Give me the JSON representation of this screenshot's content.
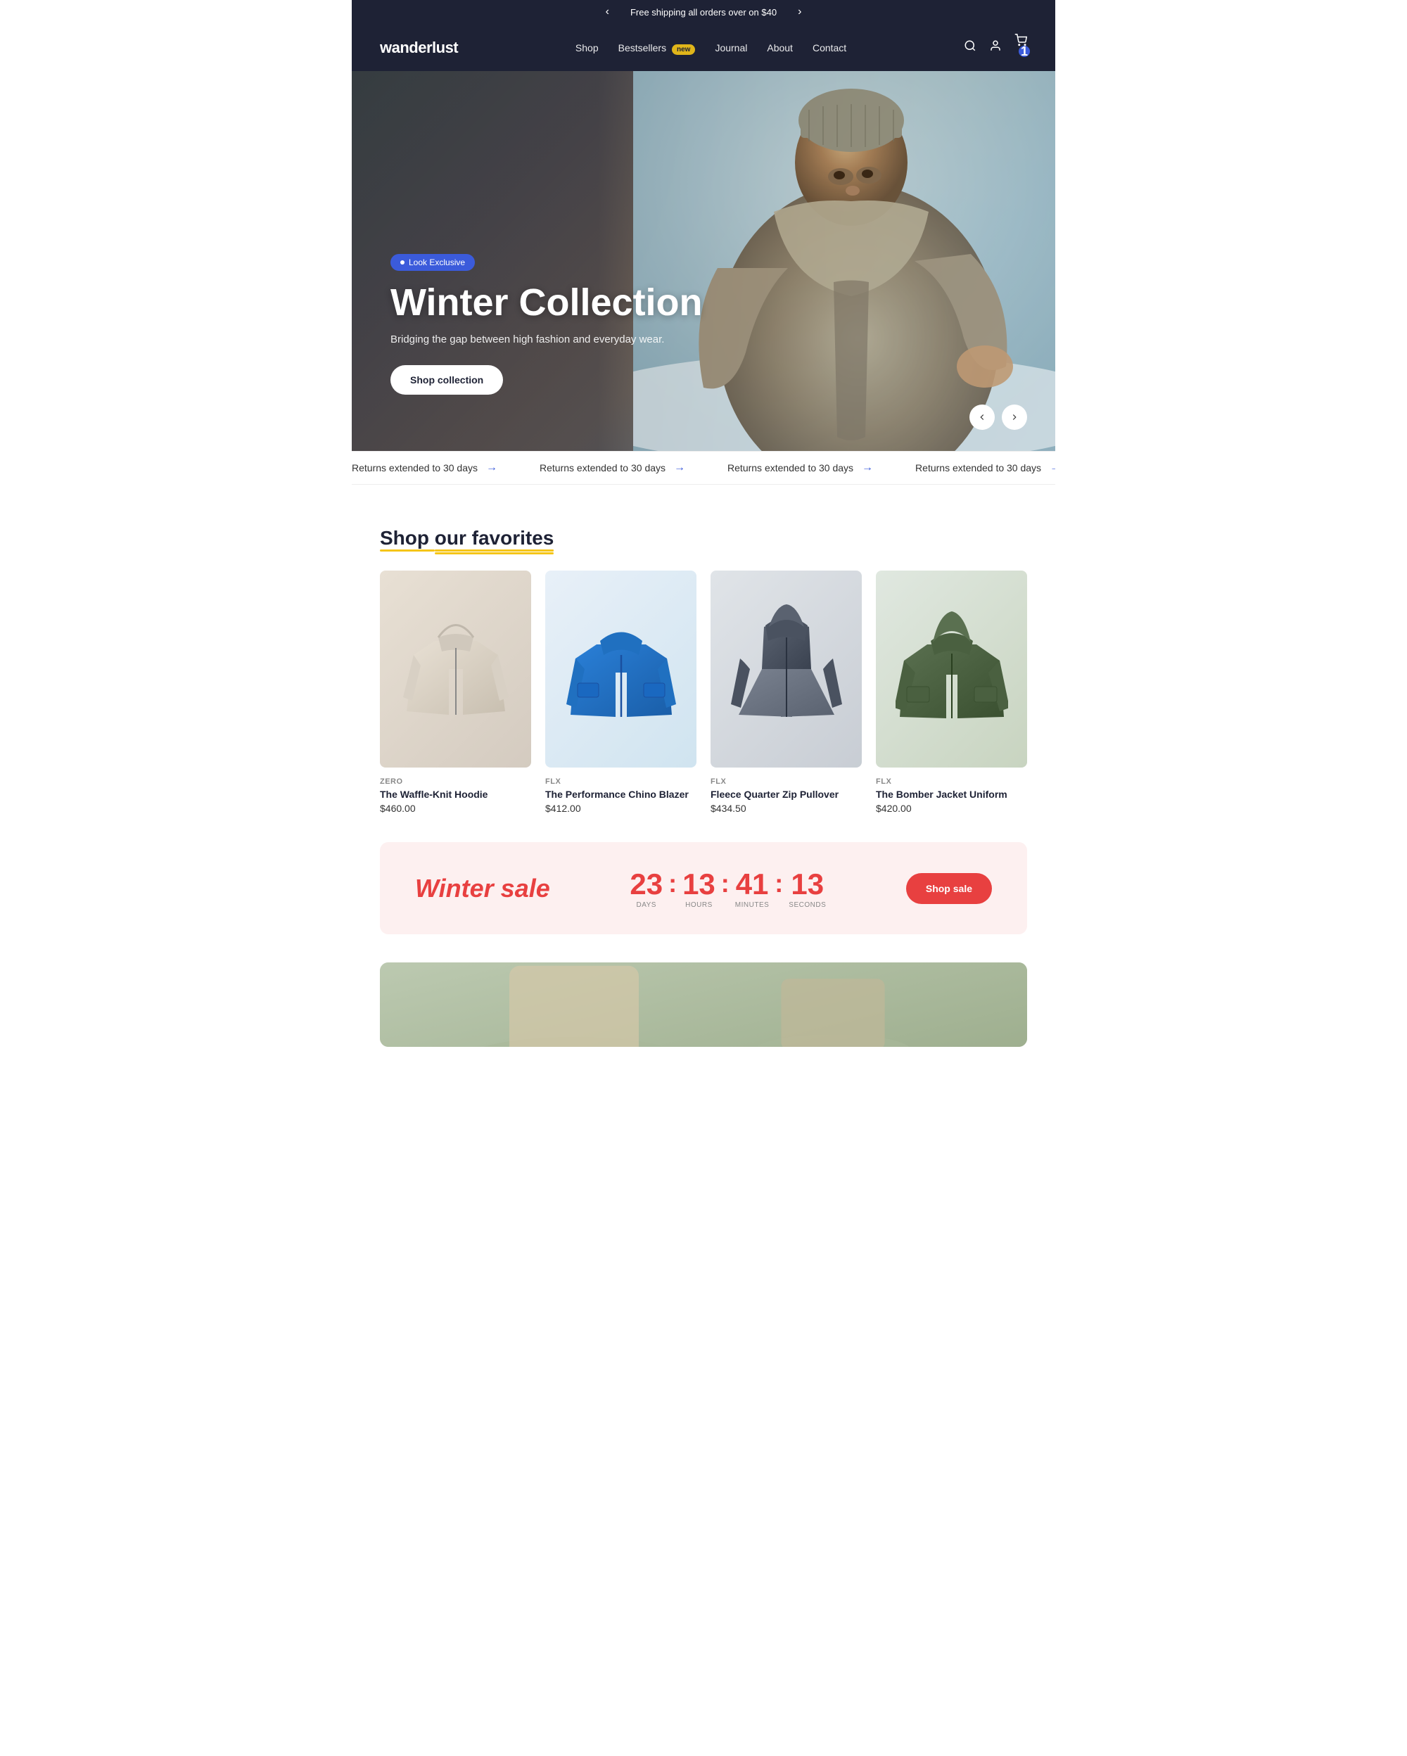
{
  "announcement": {
    "text": "Free shipping all orders over on $40",
    "prev_label": "‹",
    "next_label": "›"
  },
  "header": {
    "logo": "wanderlust",
    "nav": [
      {
        "label": "Shop",
        "id": "shop"
      },
      {
        "label": "Bestsellers",
        "id": "bestsellers",
        "badge": "new"
      },
      {
        "label": "Journal",
        "id": "journal"
      },
      {
        "label": "About",
        "id": "about"
      },
      {
        "label": "Contact",
        "id": "contact"
      }
    ],
    "cart_count": "1"
  },
  "hero": {
    "badge_text": "Look Exclusive",
    "heading": "Winter Collection",
    "subtext": "Bridging the gap between high fashion and everyday wear.",
    "cta_label": "Shop collection"
  },
  "ticker": {
    "items": [
      {
        "text": "Returns extended to 30 days"
      },
      {
        "text": "Returns extended to 30 days"
      },
      {
        "text": "Returns extended to 30 days"
      },
      {
        "text": "Returns extended to 30 days"
      }
    ]
  },
  "shop_section": {
    "title_prefix": "Shop ",
    "title_highlight": "our favorites",
    "products": [
      {
        "brand": "ZERO",
        "name": "The Waffle-Knit Hoodie",
        "price": "$460.00",
        "color_class": "jacket-1"
      },
      {
        "brand": "FLX",
        "name": "The Performance Chino Blazer",
        "price": "$412.00",
        "color_class": "jacket-2"
      },
      {
        "brand": "FLX",
        "name": "Fleece Quarter Zip Pullover",
        "price": "$434.50",
        "color_class": "jacket-3"
      },
      {
        "brand": "FLX",
        "name": "The Bomber Jacket Uniform",
        "price": "$420.00",
        "color_class": "jacket-4"
      }
    ]
  },
  "sale_banner": {
    "title": "Winter sale",
    "days": "23",
    "hours": "13",
    "minutes": "41",
    "seconds": "13",
    "days_label": "DAYS",
    "hours_label": "HOURS",
    "minutes_label": "MINUTES",
    "seconds_label": "SECONDS",
    "cta_label": "Shop sale"
  }
}
